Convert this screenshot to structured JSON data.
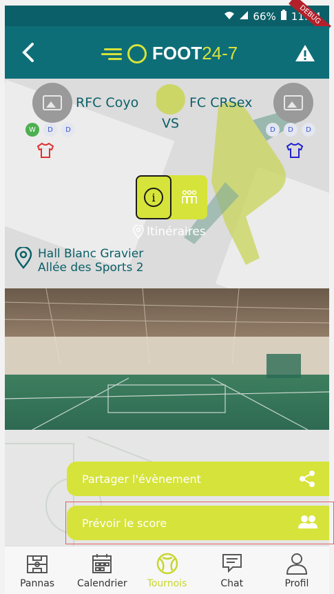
{
  "status_bar": {
    "battery": "66%",
    "time": "11:24",
    "debug_label": "DEBUG"
  },
  "app_bar": {
    "logo_text": "FOOT",
    "logo_suffix": "24-7",
    "back_icon": "chevron-left-icon",
    "warning_icon": "warning-icon"
  },
  "match": {
    "home_team": "RFC Coyo",
    "away_team": "FC CRSex",
    "vs_label": "VS",
    "home_form": [
      "W",
      "D",
      "D"
    ],
    "away_form": [
      "D",
      "D",
      "D"
    ],
    "home_shirt_color": "#e03030",
    "away_shirt_color": "#2222cc",
    "itineraries_label": "Itinéraires",
    "venue_line1": "Hall Blanc Gravier",
    "venue_line2": "Allée des Sports 2"
  },
  "buttons": {
    "share": "Partager l'évènement",
    "predict": "Prévoir le score"
  },
  "nav": [
    {
      "label": "Pannas",
      "icon": "pitch-icon",
      "active": false
    },
    {
      "label": "Calendrier",
      "icon": "calendar-icon",
      "active": false
    },
    {
      "label": "Tournois",
      "icon": "football-icon",
      "active": true
    },
    {
      "label": "Chat",
      "icon": "chat-icon",
      "active": false
    },
    {
      "label": "Profil",
      "icon": "user-icon",
      "active": false
    }
  ],
  "colors": {
    "primary": "#0e6e78",
    "accent": "#d6e33a"
  }
}
